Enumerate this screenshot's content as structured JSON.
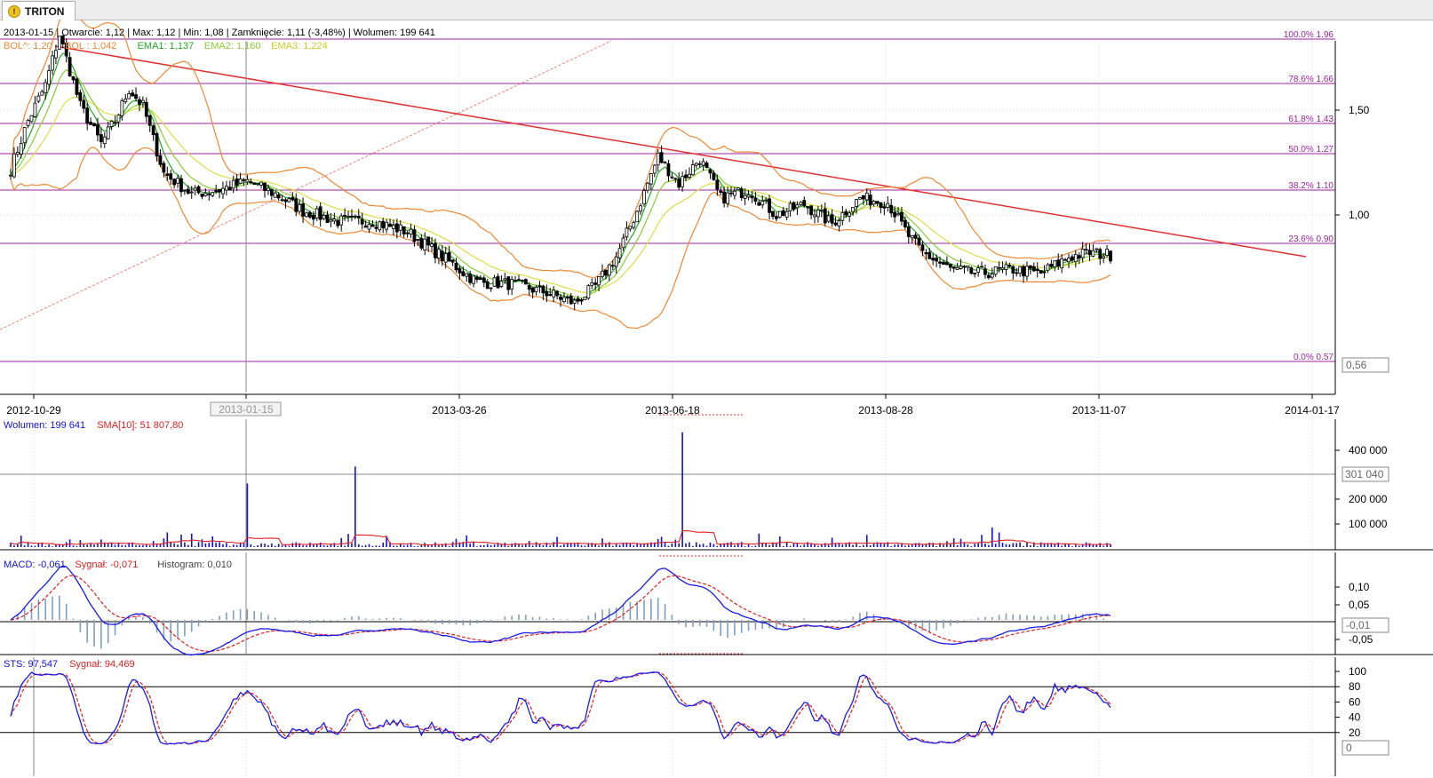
{
  "tab": {
    "label": "TRITON",
    "icon": "warning-icon"
  },
  "price_info": "2013-01-15 | Otwarcie: 1,12 | Max: 1,12 | Min: 1,08 | Zamknięcie: 1,11 (-3,48%) | Wolumen: 199 641",
  "legend": [
    {
      "text": "BOL^: 1,20",
      "color": "#ee8833"
    },
    {
      "text": "BOL  : 1,042",
      "color": "#ee8833"
    },
    {
      "text": "EMA1: 1,137",
      "color": "#22aa22"
    },
    {
      "text": "EMA2: 1,160",
      "color": "#88cc33"
    },
    {
      "text": "EMA3: 1,224",
      "color": "#cccc22"
    }
  ],
  "colors": {
    "fib": "#a020a0",
    "trend": "#e03030",
    "bollinger": "#ee8833",
    "ema1": "#22aa22",
    "ema2": "#88cc33",
    "ema3": "#dddd44",
    "volume": "#1010dd",
    "sma": "#e02020",
    "macd": "#1a1aee",
    "signal": "#e02020",
    "hist": "#7f9fbf"
  },
  "main_axis": {
    "ticks": [
      {
        "v": 1.5,
        "label": "1,50"
      },
      {
        "v": 1.0,
        "label": "1,00"
      }
    ],
    "current_label": "0,56"
  },
  "fib_levels": [
    {
      "label": "100.0% 1.96",
      "v": 1.96
    },
    {
      "label": "78.6% 1.66",
      "v": 1.66
    },
    {
      "label": "61.8% 1.43",
      "v": 1.43
    },
    {
      "label": "50.0% 1.27",
      "v": 1.27
    },
    {
      "label": "38.2% 1.10",
      "v": 1.1
    },
    {
      "label": "23.6% 0.90",
      "v": 0.9
    },
    {
      "label": "0.0% 0.57",
      "v": 0.57
    }
  ],
  "x_labels": [
    "2012-10-29",
    "2013-01-15",
    "2013-03-26",
    "2013-06-18",
    "2013-08-28",
    "2013-11-07",
    "2014-01-17"
  ],
  "crosshair_label": "2013-01-15",
  "volume_panel": {
    "title_parts": [
      {
        "text": "Wolumen: 199 641",
        "color": "#1010dd"
      },
      {
        "text": "SMA[10]: 51 807,80",
        "color": "#e02020"
      }
    ],
    "ticks": [
      "400 000",
      "200 000",
      "100 000"
    ],
    "current_label": "301 040"
  },
  "macd_panel": {
    "title_parts": [
      {
        "text": "MACD: -0,061",
        "color": "#1010dd"
      },
      {
        "text": "Sygnał: -0,071",
        "color": "#e02020"
      },
      {
        "text": "Histogram: 0,010",
        "color": "#444444"
      }
    ],
    "ticks": [
      "0,10",
      "0,05",
      "-0,05"
    ],
    "current_label": "-0,01"
  },
  "sts_panel": {
    "title_parts": [
      {
        "text": "STS: 97,547",
        "color": "#1010dd"
      },
      {
        "text": "Sygnał: 94,469",
        "color": "#e02020"
      }
    ],
    "ticks": [
      "100",
      "80",
      "60",
      "40",
      "20"
    ],
    "current_label": "0"
  },
  "chart_data": {
    "type": "line",
    "price_series": {
      "name": "TRITON",
      "x_date_labels": [
        "2012-10-29",
        "2013-01-15",
        "2013-03-26",
        "2013-06-18",
        "2013-08-28",
        "2013-11-07",
        "2014-01-17"
      ],
      "key_points": [
        {
          "i": 0,
          "v": 1.22
        },
        {
          "i": 5,
          "v": 1.45
        },
        {
          "i": 10,
          "v": 1.62
        },
        {
          "i": 14,
          "v": 1.86
        },
        {
          "i": 20,
          "v": 1.52
        },
        {
          "i": 26,
          "v": 1.34
        },
        {
          "i": 30,
          "v": 1.45
        },
        {
          "i": 34,
          "v": 1.6
        },
        {
          "i": 38,
          "v": 1.52
        },
        {
          "i": 44,
          "v": 1.2
        },
        {
          "i": 52,
          "v": 1.1
        },
        {
          "i": 60,
          "v": 1.12
        },
        {
          "i": 68,
          "v": 1.16
        },
        {
          "i": 76,
          "v": 1.1
        },
        {
          "i": 84,
          "v": 1.02
        },
        {
          "i": 94,
          "v": 0.97
        },
        {
          "i": 104,
          "v": 0.97
        },
        {
          "i": 114,
          "v": 0.92
        },
        {
          "i": 124,
          "v": 0.8
        },
        {
          "i": 134,
          "v": 0.68
        },
        {
          "i": 144,
          "v": 0.67
        },
        {
          "i": 154,
          "v": 0.63
        },
        {
          "i": 162,
          "v": 0.58
        },
        {
          "i": 168,
          "v": 0.66
        },
        {
          "i": 174,
          "v": 0.8
        },
        {
          "i": 180,
          "v": 1.02
        },
        {
          "i": 186,
          "v": 1.28
        },
        {
          "i": 192,
          "v": 1.15
        },
        {
          "i": 198,
          "v": 1.27
        },
        {
          "i": 204,
          "v": 1.08
        },
        {
          "i": 212,
          "v": 1.12
        },
        {
          "i": 220,
          "v": 1.0
        },
        {
          "i": 228,
          "v": 1.05
        },
        {
          "i": 236,
          "v": 0.96
        },
        {
          "i": 244,
          "v": 1.08
        },
        {
          "i": 252,
          "v": 1.06
        },
        {
          "i": 258,
          "v": 0.9
        },
        {
          "i": 262,
          "v": 0.82
        },
        {
          "i": 270,
          "v": 0.74
        },
        {
          "i": 278,
          "v": 0.72
        },
        {
          "i": 288,
          "v": 0.74
        },
        {
          "i": 296,
          "v": 0.72
        },
        {
          "i": 304,
          "v": 0.8
        },
        {
          "i": 310,
          "v": 0.82
        },
        {
          "i": 316,
          "v": 0.81
        }
      ]
    },
    "fibonacci": [
      1.96,
      1.66,
      1.43,
      1.27,
      1.1,
      0.9,
      0.57
    ],
    "trend_line": [
      {
        "date": "2012-11-12",
        "v": 1.96
      },
      {
        "date": "2014-01-10",
        "v": 0.81
      }
    ],
    "ylim": [
      0.5,
      2.0
    ]
  }
}
